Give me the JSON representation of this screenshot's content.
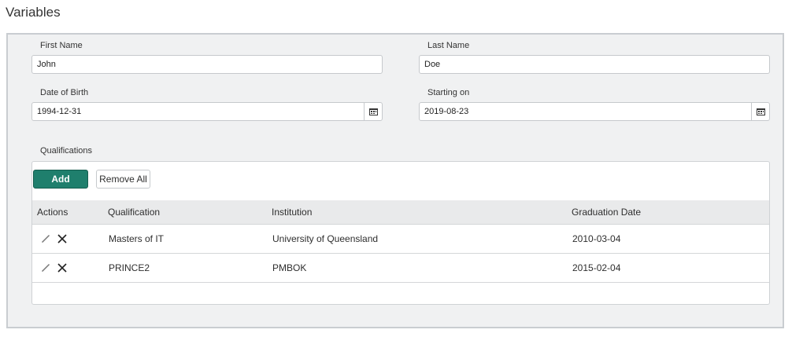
{
  "title": "Variables",
  "fields": {
    "first_name": {
      "label": "First Name",
      "value": "John"
    },
    "last_name": {
      "label": "Last Name",
      "value": "Doe"
    },
    "dob": {
      "label": "Date of Birth",
      "value": "1994-12-31"
    },
    "start": {
      "label": "Starting on",
      "value": "2019-08-23"
    }
  },
  "qualifications": {
    "label": "Qualifications",
    "add": "Add",
    "remove_all": "Remove All",
    "columns": [
      "Actions",
      "Qualification",
      "Institution",
      "Graduation Date"
    ],
    "rows": [
      {
        "qualification": "Masters of IT",
        "institution": "University of Queensland",
        "date": "2010-03-04"
      },
      {
        "qualification": "PRINCE2",
        "institution": "PMBOK",
        "date": "2015-02-04"
      }
    ]
  },
  "colors": {
    "accent": "#1f7f6d"
  }
}
